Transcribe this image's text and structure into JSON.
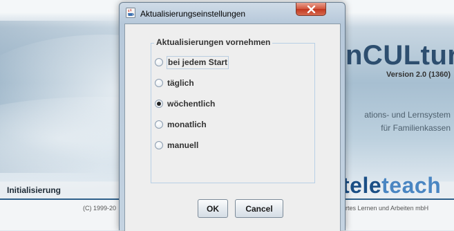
{
  "background": {
    "app_title": "nCULtur",
    "version": "Version 2.0 (1360)",
    "subtitle_line1": "ations- und Lernsystem",
    "subtitle_line2": "für Familienkassen",
    "status_label": "Initialisierung",
    "copyright": "(C) 1999-20",
    "logo_part1": "tele",
    "logo_part2": "teach",
    "tagline": "rtes Lernen und Arbeiten mbH",
    "colors": {
      "logo_dark": "#1b4f86",
      "logo_light": "#4a86c2",
      "separator": "#2d5f8a"
    }
  },
  "dialog": {
    "title": "Aktualisierungseinstellungen",
    "group_title": "Aktualisierungen vornehmen",
    "options": [
      {
        "label": "bei jedem Start",
        "checked": false,
        "focused": true
      },
      {
        "label": "täglich",
        "checked": false,
        "focused": false
      },
      {
        "label": "wöchentlich",
        "checked": true,
        "focused": false
      },
      {
        "label": "monatlich",
        "checked": false,
        "focused": false
      },
      {
        "label": "manuell",
        "checked": false,
        "focused": false
      }
    ],
    "ok_label": "OK",
    "cancel_label": "Cancel",
    "icons": {
      "app": "java-cup-icon",
      "close": "close-icon"
    }
  }
}
